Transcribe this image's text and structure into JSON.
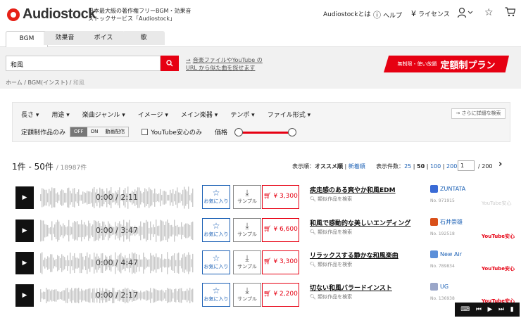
{
  "header": {
    "logo_text": "Audiostock",
    "tagline": "日本最大級の著作権フリーBGM・効果音ストックサービス「Audiostock」",
    "nav_about": "Audiostockとは",
    "nav_help": "ヘルプ",
    "nav_license": "ライセンス"
  },
  "tabs": [
    "BGM",
    "効果音",
    "ボイス",
    "歌"
  ],
  "search": {
    "value": "和風",
    "yt_link_line1": "音楽ファイルやYouTube の",
    "yt_link_line2": "URL から似た曲を探せます",
    "plan_small": "無制限・使い放題",
    "plan_big": "定額制プラン"
  },
  "breadcrumb": [
    "ホーム",
    "BGM(インスト)",
    "和風"
  ],
  "filters": {
    "items": [
      "長さ ▾",
      "用途 ▾",
      "楽曲ジャンル ▾",
      "イメージ ▾",
      "メイン楽器 ▾",
      "テンポ ▾",
      "ファイル形式 ▾"
    ],
    "advanced": "→ さらに詳細な検索",
    "subscription_only": "定額制作品のみ",
    "toggle_off": "OFF",
    "toggle_on": "ON",
    "toggle_stream": "動画配信",
    "youtube_safe": "YouTube安心のみ",
    "price_label": "価格",
    "price_range": [
      0,
      1
    ]
  },
  "results": {
    "range": "1件 - 50件",
    "total": "/ 18987件",
    "sort_label": "表示順：",
    "sort_current": "オススメ順",
    "sort_sep": "|",
    "sort_alt": "新着順",
    "per_page_label": "表示件数：",
    "per_page_25": "25",
    "per_page_50": "50",
    "per_page_100": "100",
    "per_page_200": "200",
    "page": "1",
    "page_total": "/ 200",
    "next": "›"
  },
  "track_actions": {
    "favorite": "お気に入り",
    "sample": "サンプル",
    "similar": "類似作品を検索"
  },
  "tracks": [
    {
      "time": "0:00 / 2:11",
      "price": "¥ 3,300",
      "title": "疾走感のある爽やか和風EDM",
      "artist": "ZUNTATA",
      "no": "No. 971915",
      "youtube": "YouTube安心",
      "yt_red": false
    },
    {
      "time": "0:00 / 3:47",
      "price": "¥ 6,600",
      "title": "和風で感動的な美しいエンディング",
      "artist": "石井崇雄",
      "no": "No. 192518",
      "youtube": "YouTube安心",
      "yt_red": true
    },
    {
      "time": "0:00 / 4:47",
      "price": "¥ 3,300",
      "title": "リラックスする静かな和風楽曲",
      "artist": "New Air",
      "no": "No. 789834",
      "youtube": "YouTube安心",
      "yt_red": true
    },
    {
      "time": "0:00 / 2:17",
      "price": "¥ 2,200",
      "title": "切ない和風バラードインスト",
      "artist": "UG",
      "no": "No. 136938",
      "youtube": "YouTube安心",
      "yt_red": true
    }
  ],
  "colors": {
    "accent": "#e60012",
    "link": "#1a5fb4"
  }
}
